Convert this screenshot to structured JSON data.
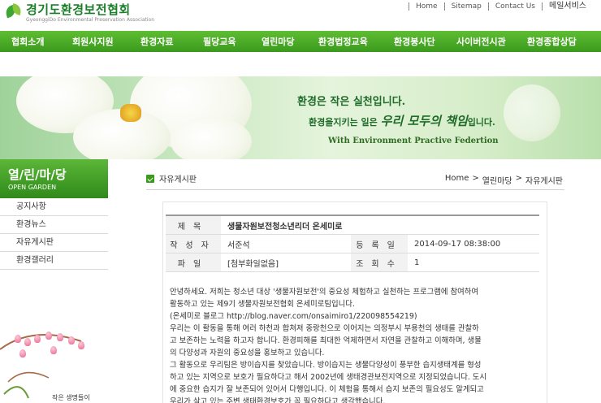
{
  "header": {
    "logo_kr": "경기도환경보전협회",
    "logo_en": "GyeonggiDo Environmental Preservation Association",
    "util_links": [
      "Home",
      "Sitemap",
      "Contact Us",
      "메일서비스"
    ]
  },
  "gnb": {
    "items": [
      "협회소개",
      "회원사지원",
      "환경자료",
      "필당교육",
      "열린마당",
      "환경법정교육",
      "환경봉사단",
      "사이버전시관",
      "환경종합상담"
    ]
  },
  "banner": {
    "line1": "환경은 작은 실천입니다.",
    "line2_prefix": "환경을지키는 일은",
    "line2_emph": "우리 모두의 책임",
    "line2_suffix": "입니다.",
    "line3": "With Environment Practive Federtion"
  },
  "sidebar": {
    "title_kr": "열/린/마/당",
    "title_en": "OPEN GARDEN",
    "items": [
      "공지사항",
      "환경뉴스",
      "자유게시판",
      "환경갤러리"
    ],
    "caption": "작은 생명들이"
  },
  "section": {
    "title": "자유게시판",
    "breadcrumb": [
      "Home",
      ">",
      "열린마당",
      ">",
      "자유게시판"
    ]
  },
  "post": {
    "subject_label": "제목",
    "subject": "생물자원보전청소년리더 온세미로",
    "author_label": "작성자",
    "author": "서준석",
    "date_label": "등록일",
    "date": "2014-09-17 08:38:00",
    "file_label": "파일",
    "file": "[첨부화일없음]",
    "views_label": "조회수",
    "views": "1",
    "body": "안녕하세요. 저희는 청소년 대상 '생물자원보전'의 중요성 체험하고 실천하는 프로그램에 참여하여\n활동하고 있는 제9기 생물자원보전협회 온세미로팀입니다.\n(온세미로 블로그 http://blog.naver.com/onsaimiro1/220098554219)\n 우리는 이 활동을 통해 여러 하천과 합쳐져 중랑천으로 이어지는 의정부시 부용천의 생태를 관찰하\n고 보존하는 노력을 하고자 합니다. 환경피해를 최대한 억제하면서 자연을 관찰하고 이해하며, 생물\n의 다양성과 자원의 중요성을 홍보하고 있습니다.\n 그 활동으로 우리팀은 방이습지를 찾았습니다.  방이습지는 생물다양성이 풍부한 습지생태계를 형성\n하고 있는 지역으로 보호가 필요하다고 해서 2002년에 생태경관보전지역으로 지정되었습니다. 도시\n에 중요한 습지가 잘 보존되어 있어서 다행입니다. 이 체험을 통해서 습지 보존의 필요성도 알게되고\n우리가 살고 있는 주변 생태환경보호가 꼭 필요하다고 생각했습니다."
  },
  "colors": {
    "brand_green": "#3a9a1c",
    "nav_green": "#5fbd33"
  }
}
